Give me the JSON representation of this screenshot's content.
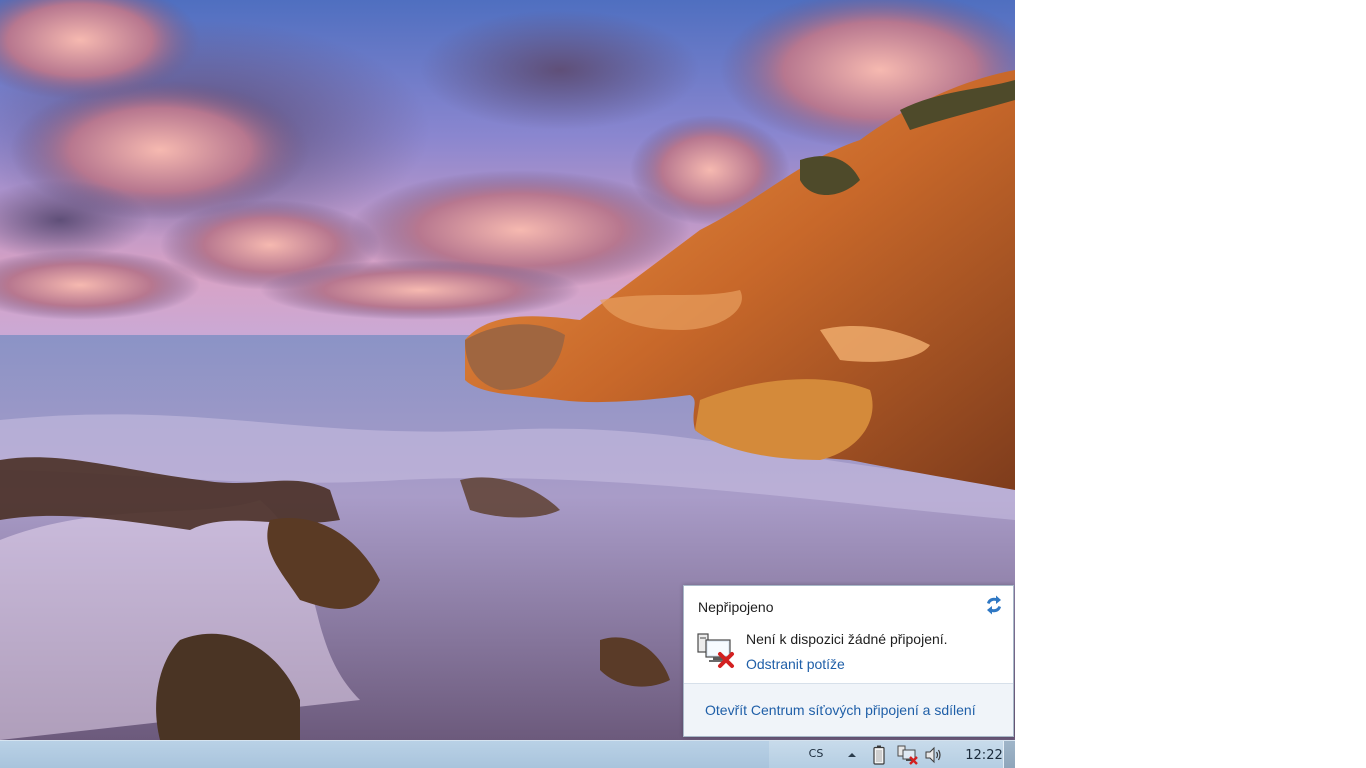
{
  "flyout": {
    "title": "Nepřipojeno",
    "status_text": "Není k dispozici žádné připojení.",
    "troubleshoot_label": "Odstranit potíže",
    "footer_link": "Otevřít Centrum síťových připojení a sdílení",
    "refresh_icon": "refresh-arrows-icon",
    "status_icon": "network-disconnected-icon"
  },
  "taskbar": {
    "language": "CS",
    "clock": "12:22",
    "icons": [
      "show-hidden-icons-icon",
      "battery-icon",
      "network-disconnected-icon",
      "volume-icon"
    ]
  },
  "colors": {
    "taskbar": "#b9d1e6",
    "link": "#1f5fa8",
    "error_red": "#d32020"
  }
}
